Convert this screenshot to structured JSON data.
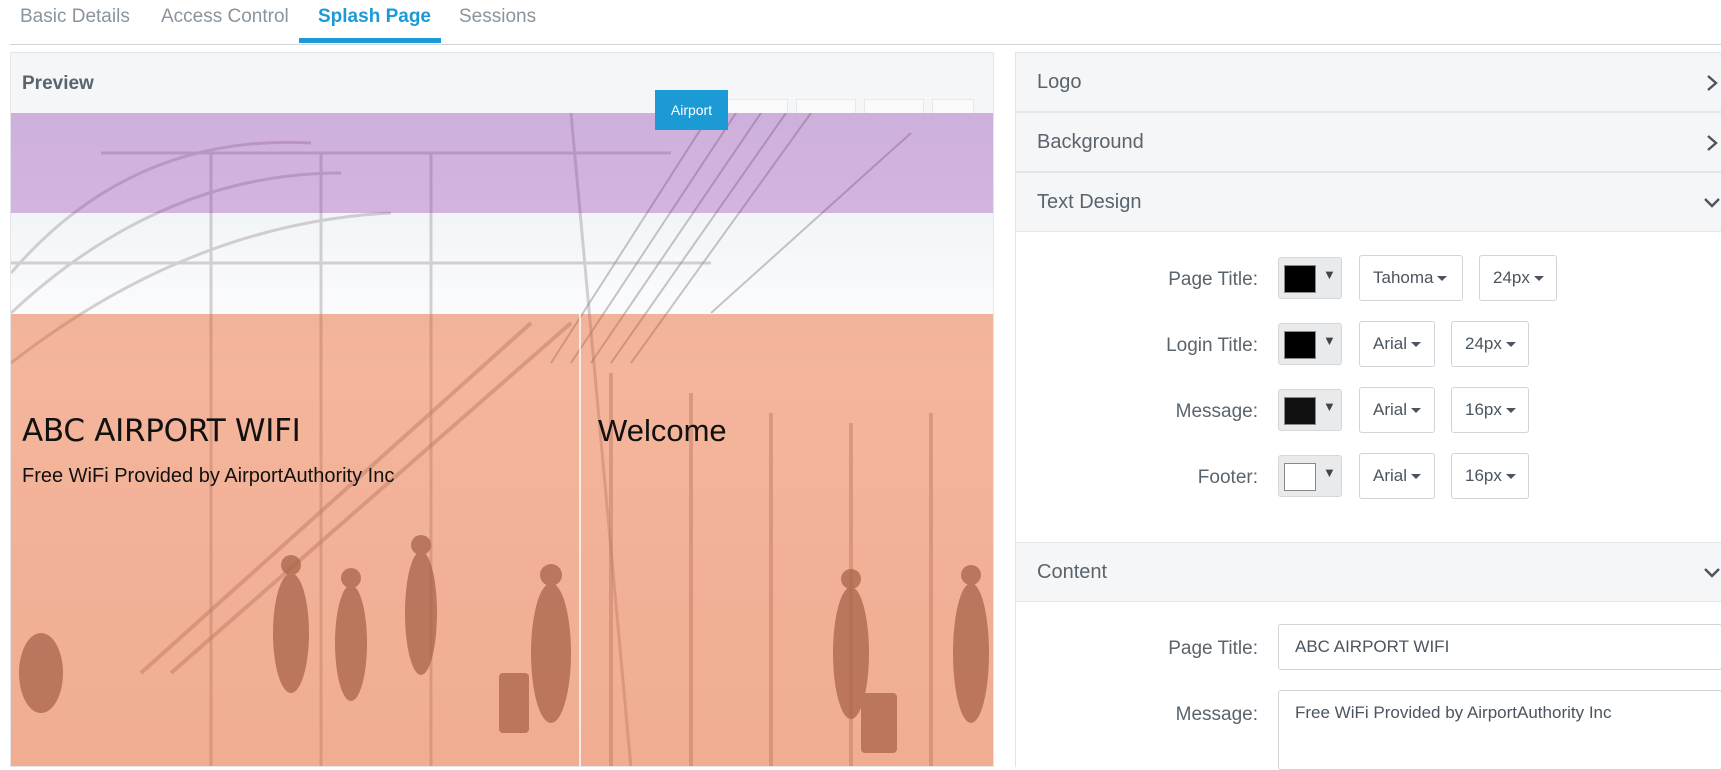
{
  "tabs": [
    {
      "label": "Basic Details"
    },
    {
      "label": "Access Control"
    },
    {
      "label": "Splash Page",
      "active": true
    },
    {
      "label": "Sessions"
    }
  ],
  "preview": {
    "title": "Preview",
    "chip": "Airport",
    "page_title": "ABC AIRPORT WIFI",
    "message": "Free WiFi Provided by AirportAuthority Inc",
    "welcome": "Welcome"
  },
  "settings": {
    "logo": {
      "label": "Logo",
      "chevron": "chevron-right-icon"
    },
    "background": {
      "label": "Background",
      "chevron": "chevron-right-icon"
    },
    "text_design": {
      "label": "Text Design",
      "chevron": "chevron-down-icon",
      "rows": [
        {
          "label": "Page Title:",
          "color": "#000000",
          "font": "Tahoma",
          "size": "24px"
        },
        {
          "label": "Login Title:",
          "color": "#000000",
          "font": "Arial",
          "size": "24px"
        },
        {
          "label": "Message:",
          "color": "#111111",
          "font": "Arial",
          "size": "16px"
        },
        {
          "label": "Footer:",
          "color": "#ffffff",
          "font": "Arial",
          "size": "16px"
        }
      ]
    },
    "content": {
      "label": "Content",
      "chevron": "chevron-down-icon",
      "page_title_label": "Page Title:",
      "page_title_value": "ABC AIRPORT WIFI",
      "message_label": "Message:",
      "message_value": "Free WiFi Provided by AirportAuthority Inc"
    }
  },
  "colors": {
    "accent": "#1b9ad6",
    "purple_band": "#c084ce",
    "orange_band": "#ee8860"
  }
}
